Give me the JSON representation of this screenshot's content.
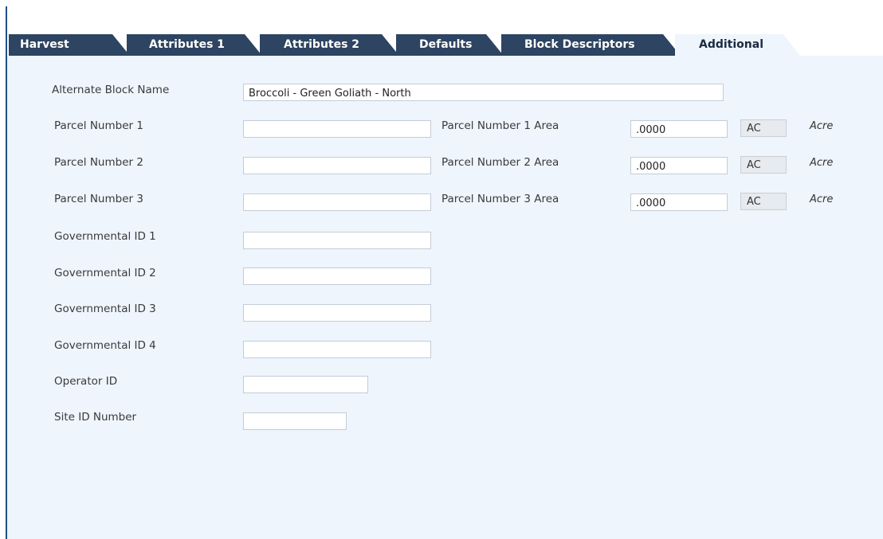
{
  "tabs": [
    {
      "label": "Harvest",
      "active": false
    },
    {
      "label": "Attributes 1",
      "active": false
    },
    {
      "label": "Attributes 2",
      "active": false
    },
    {
      "label": "Defaults",
      "active": false
    },
    {
      "label": "Block Descriptors",
      "active": false
    },
    {
      "label": "Additional",
      "active": true
    }
  ],
  "form": {
    "alternate_block_name": {
      "label": "Alternate Block Name",
      "value": "Broccoli - Green Goliath - North"
    },
    "parcel_1": {
      "label": "Parcel Number 1",
      "value": ""
    },
    "parcel_2": {
      "label": "Parcel Number 2",
      "value": ""
    },
    "parcel_3": {
      "label": "Parcel Number 3",
      "value": ""
    },
    "parcel_1_area": {
      "label": "Parcel Number 1 Area",
      "value": ".0000",
      "uom": "AC",
      "uom_desc": "Acre"
    },
    "parcel_2_area": {
      "label": "Parcel Number 2 Area",
      "value": ".0000",
      "uom": "AC",
      "uom_desc": "Acre"
    },
    "parcel_3_area": {
      "label": "Parcel Number 3 Area",
      "value": ".0000",
      "uom": "AC",
      "uom_desc": "Acre"
    },
    "gov_id_1": {
      "label": "Governmental ID 1",
      "value": ""
    },
    "gov_id_2": {
      "label": "Governmental ID 2",
      "value": ""
    },
    "gov_id_3": {
      "label": "Governmental ID 3",
      "value": ""
    },
    "gov_id_4": {
      "label": "Governmental ID 4",
      "value": ""
    },
    "operator_id": {
      "label": "Operator ID",
      "value": ""
    },
    "site_id": {
      "label": "Site ID Number",
      "value": ""
    }
  },
  "colors": {
    "tab_inactive": "#2d4462",
    "panel_bg": "#eef5fd",
    "frame_border": "#1f4f88"
  }
}
